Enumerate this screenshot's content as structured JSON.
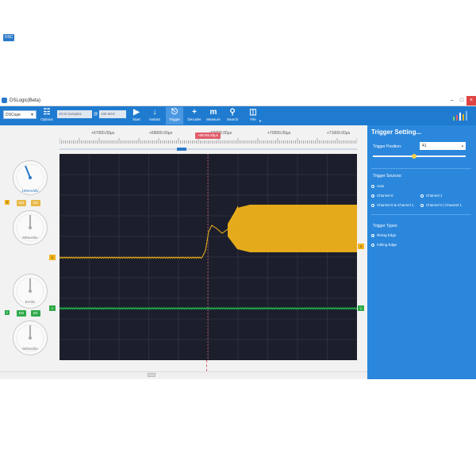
{
  "window": {
    "title": "DSLogic(Beta)"
  },
  "toolbar": {
    "device": "DSCope",
    "options_label": "Options",
    "samples_placeholder": "16 M Samples",
    "at_symbol": "@",
    "rate_placeholder": "100 MHz",
    "buttons": [
      {
        "id": "start",
        "label": "Start",
        "icon": "play-icon"
      },
      {
        "id": "instant",
        "label": "Instant",
        "icon": "download-arrow-icon"
      },
      {
        "id": "trigger",
        "label": "Trigger",
        "icon": "trigger-icon",
        "active": true
      },
      {
        "id": "decoder",
        "label": "Decoder",
        "icon": "plus-icon"
      },
      {
        "id": "measure",
        "label": "Measure",
        "icon": "measure-icon"
      },
      {
        "id": "search",
        "label": "Search",
        "icon": "search-icon"
      },
      {
        "id": "file",
        "label": "File",
        "icon": "file-icon"
      }
    ]
  },
  "left": {
    "osc_label": "OSC",
    "ch0": {
      "volts": "100mV/div",
      "time": "500us/div",
      "en": "EN",
      "dc": "DC",
      "index": "0"
    },
    "ch1": {
      "volts": "5V/div",
      "time": "500us/div",
      "en": "EN",
      "dc": "DC",
      "index": "1"
    }
  },
  "ruler": {
    "labels": [
      "+67000.00μs",
      "+68000.00μs",
      "+69000.00μs",
      "+70000.00μs",
      "+71000.00μs"
    ],
    "cursor": "+68786.58μs"
  },
  "scope": {
    "ch0_marker": "0",
    "ch1_marker": "1",
    "colors": {
      "ch0": "#f0b21a",
      "ch1": "#1fb64a",
      "bg": "#1c1f2b",
      "grid": "#3a3f52"
    }
  },
  "panel": {
    "title": "Trigger Setting...",
    "position_label": "Trigger Position:",
    "position_value": "41",
    "sources_label": "Trigger Sources:",
    "sources": [
      {
        "label": "Auto",
        "selected": false
      },
      {
        "label": "Channel 0",
        "selected": true
      },
      {
        "label": "Channel 1",
        "selected": false
      },
      {
        "label": "Channel 0 & Channel 1",
        "selected": false
      },
      {
        "label": "Channel 0 | Channel 1",
        "selected": false
      }
    ],
    "types_label": "Trigger Types:",
    "types": [
      {
        "label": "Rising Edge",
        "selected": true
      },
      {
        "label": "Falling Edge",
        "selected": false
      }
    ]
  }
}
